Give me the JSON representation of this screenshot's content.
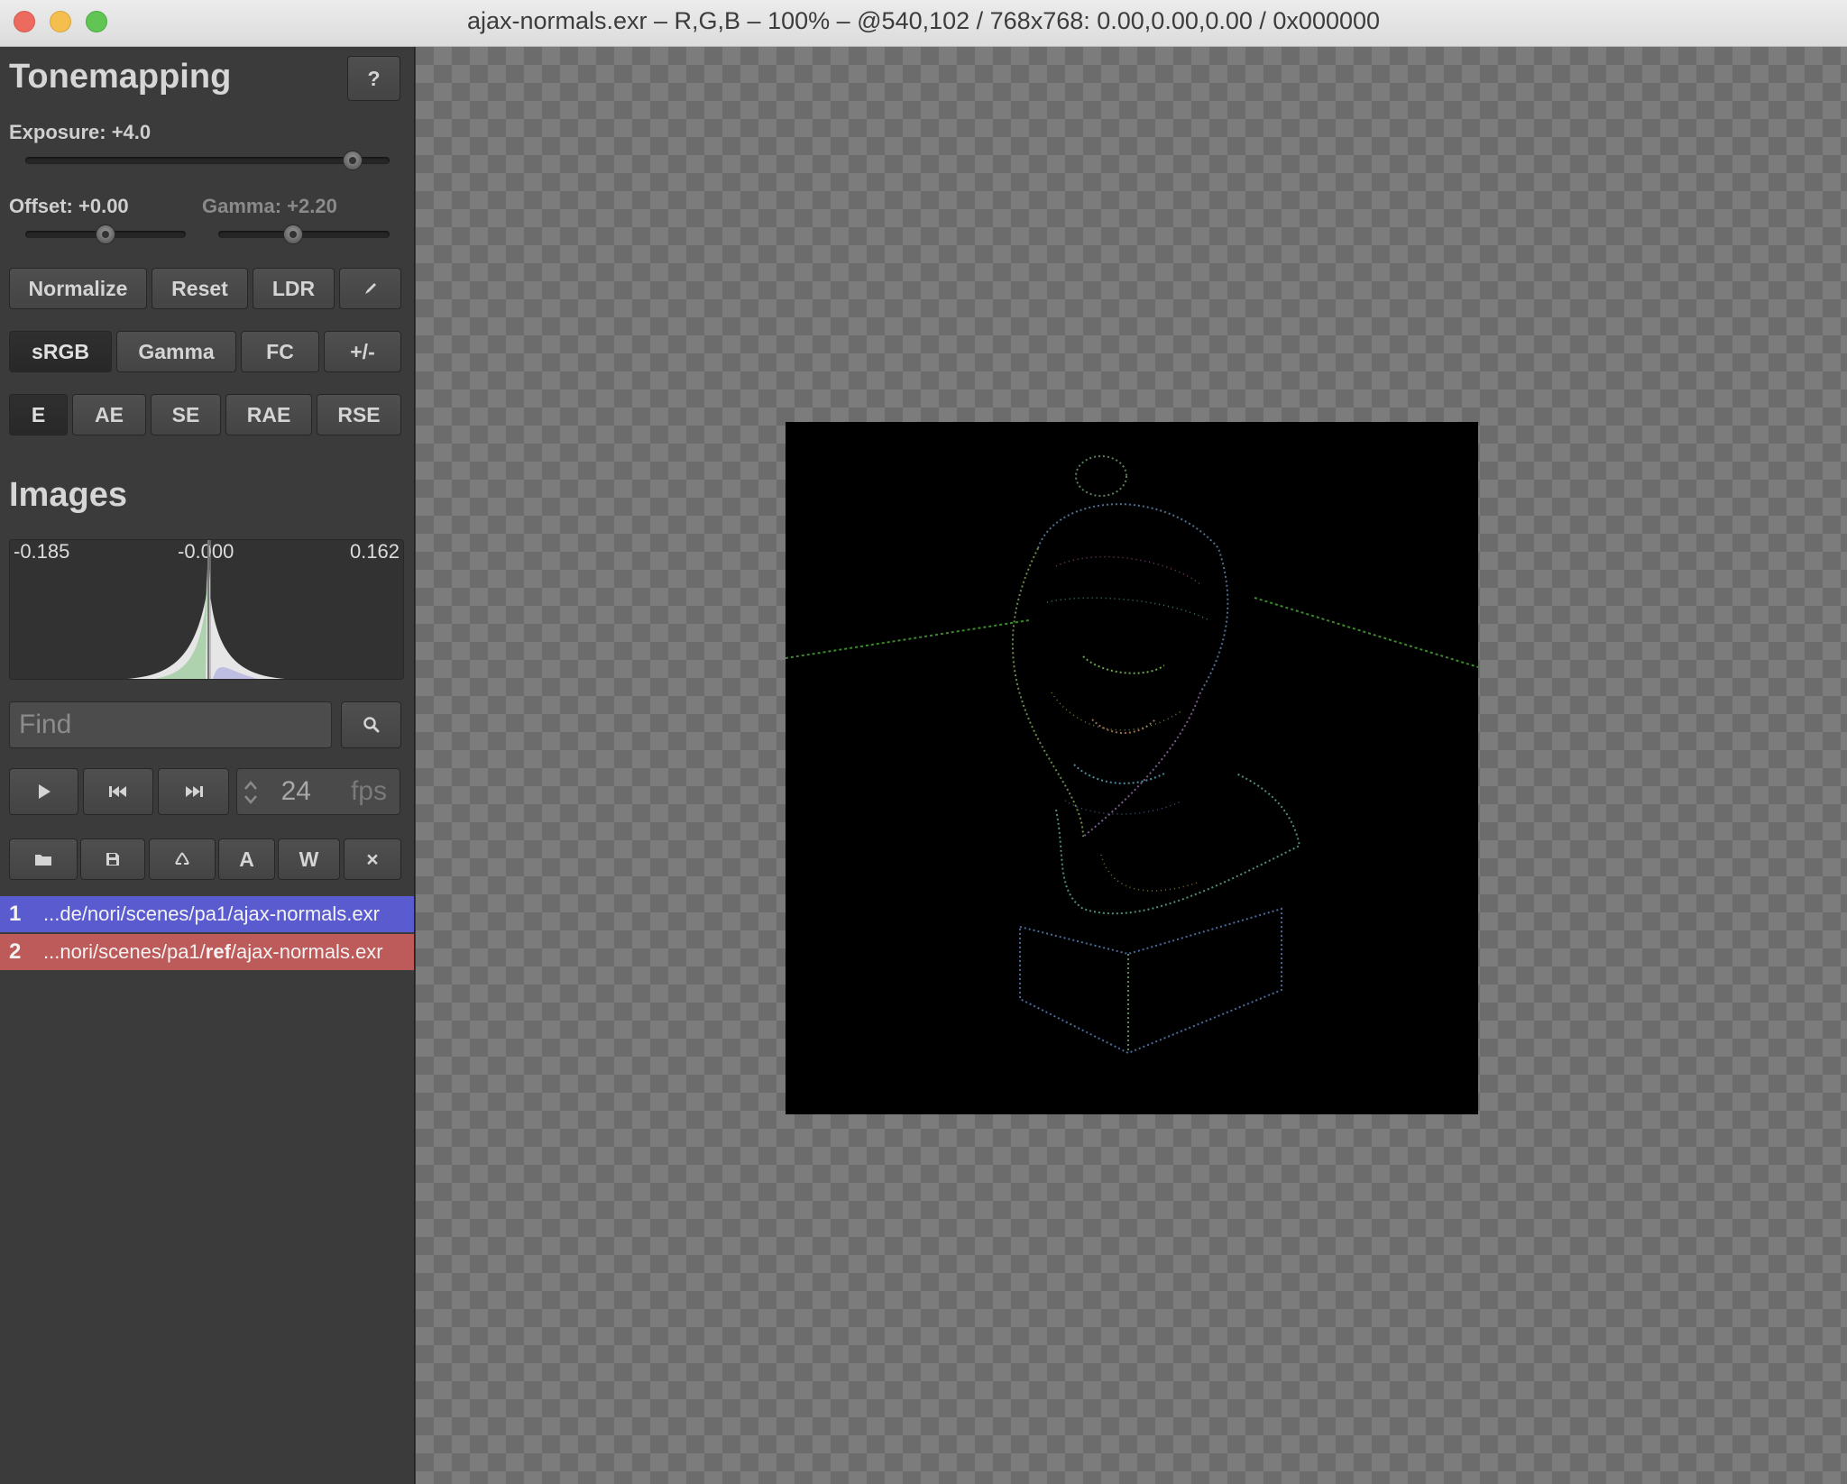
{
  "window": {
    "title": "ajax-normals.exr – R,G,B – 100% – @540,102 / 768x768: 0.00,0.00,0.00 / 0x000000"
  },
  "tonemapping": {
    "heading": "Tonemapping",
    "help_label": "?",
    "exposure_label": "Exposure: +4.0",
    "exposure_value": 4.0,
    "offset_label": "Offset: +0.00",
    "offset_value": 0.0,
    "gamma_label": "Gamma: +2.20",
    "gamma_value": 2.2,
    "buttons_row1": [
      "Normalize",
      "Reset",
      "LDR"
    ],
    "brush_icon": "brush-icon",
    "buttons_row2": [
      "sRGB",
      "Gamma",
      "FC",
      "+/-"
    ],
    "buttons_row3": [
      "E",
      "AE",
      "SE",
      "RAE",
      "RSE"
    ],
    "active_tonemap": "sRGB",
    "active_metric": "E"
  },
  "images": {
    "heading": "Images",
    "histogram": {
      "min_label": "-0.185",
      "mid_label": "-0.000",
      "max_label": "0.162"
    },
    "find_placeholder": "Find",
    "search_icon": "search-icon",
    "playback": {
      "play_icon": "play-icon",
      "prev_icon": "skip-back-icon",
      "next_icon": "skip-forward-icon",
      "fps_value": "24",
      "fps_unit": "fps"
    },
    "file_actions": {
      "open_icon": "folder-icon",
      "save_icon": "save-icon",
      "reload_icon": "recycle-icon",
      "reload_all_label": "A",
      "watch_label": "W",
      "close_label": "×"
    },
    "list": [
      {
        "index": "1",
        "path": "...de/nori/scenes/pa1/ajax-normals.exr",
        "color": "#5b5bd0"
      },
      {
        "index": "2",
        "path_pre": "...nori/scenes/pa1/",
        "path_bold": "ref",
        "path_post": "/ajax-normals.exr",
        "color": "#bd5a5a"
      }
    ]
  }
}
